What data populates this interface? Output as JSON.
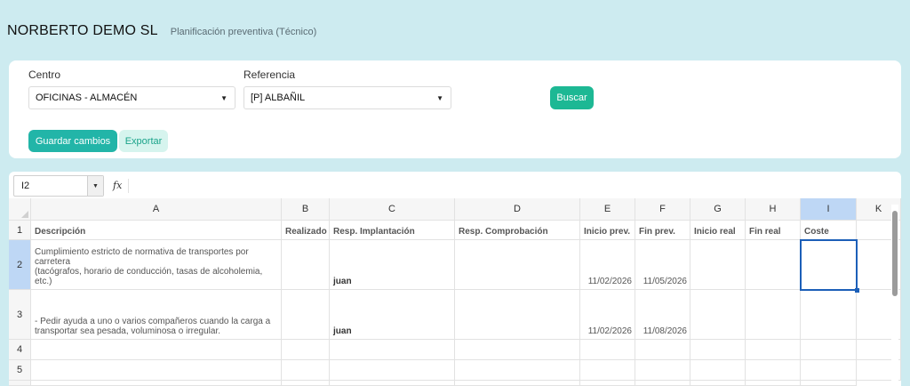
{
  "header": {
    "company": "NORBERTO DEMO SL",
    "subtitle": "Planificación preventiva (Técnico)"
  },
  "filters": {
    "centro_label": "Centro",
    "centro_value": "OFICINAS - ALMACÉN",
    "referencia_label": "Referencia",
    "referencia_value": "[P] ALBAÑIL",
    "search_label": "Buscar",
    "save_label": "Guardar cambios",
    "export_label": "Exportar"
  },
  "sheet": {
    "cell_ref": "I2",
    "fx_label": "fx",
    "columns": [
      "A",
      "B",
      "C",
      "D",
      "E",
      "F",
      "G",
      "H",
      "I",
      "K"
    ],
    "row_numbers": [
      "1",
      "2",
      "3",
      "4",
      "5"
    ],
    "headers": [
      "Descripción",
      "Realizado",
      "Resp. Implantación",
      "Resp. Comprobación",
      "Inicio prev.",
      "Fin prev.",
      "Inicio real",
      "Fin real",
      "Coste",
      ""
    ],
    "rows": [
      {
        "descripcion_l1": "Cumplimiento estricto de normativa de transportes por carretera",
        "descripcion_l2": "(tacógrafos, horario de conducción, tasas de alcoholemia, etc.)",
        "realizado": "",
        "resp_implantacion": "juan",
        "resp_comprobacion": "",
        "inicio_prev": "11/02/2026",
        "fin_prev": "11/05/2026",
        "inicio_real": "",
        "fin_real": "",
        "coste": ""
      },
      {
        "descripcion_l1": "- Pedir ayuda a uno o varios compañeros cuando la carga a",
        "descripcion_l2": "transportar sea pesada, voluminosa o irregular.",
        "realizado": "",
        "resp_implantacion": "juan",
        "resp_comprobacion": "",
        "inicio_prev": "11/02/2026",
        "fin_prev": "11/08/2026",
        "inicio_real": "",
        "fin_real": "",
        "coste": ""
      }
    ]
  },
  "colors": {
    "background": "#cdebf0",
    "primary_button": "#1db894",
    "selection": "#1c5fb8"
  }
}
